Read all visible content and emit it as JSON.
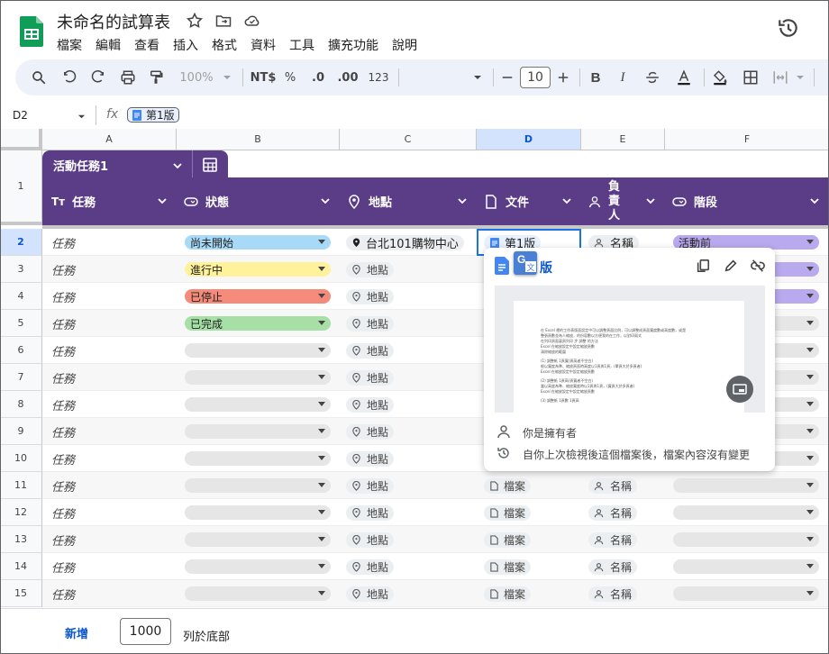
{
  "app": {
    "title": "未命名的試算表",
    "menus": [
      "檔案",
      "編輯",
      "查看",
      "插入",
      "格式",
      "資料",
      "工具",
      "擴充功能",
      "說明"
    ]
  },
  "toolbar": {
    "zoom": "100%",
    "currency": "NT$",
    "percent": "%",
    "dec_decrease": ".0",
    "dec_increase": ".00",
    "number_format": "123",
    "font_size": "10",
    "bold": "B",
    "italic": "I"
  },
  "formula_bar": {
    "cell_ref": "D2",
    "fx": "fx",
    "content": "第1版"
  },
  "columns": [
    "A",
    "B",
    "C",
    "D",
    "E",
    "F"
  ],
  "table": {
    "name": "活動任務1",
    "headers": {
      "task": "任務",
      "status": "狀態",
      "location": "地點",
      "document": "文件",
      "owner": "負責人",
      "stage": "階段"
    },
    "rows": [
      {
        "num": "2",
        "task": "任務",
        "status": "尚未開始",
        "location": "台北101購物中心",
        "document": "第1版",
        "owner": "名稱",
        "stage": "活動前"
      },
      {
        "num": "3",
        "task": "任務",
        "status": "進行中",
        "location": "地點",
        "document": "",
        "owner": "",
        "stage": ""
      },
      {
        "num": "4",
        "task": "任務",
        "status": "已停止",
        "location": "地點",
        "document": "",
        "owner": "",
        "stage": ""
      },
      {
        "num": "5",
        "task": "任務",
        "status": "已完成",
        "location": "地點",
        "document": "",
        "owner": "",
        "stage": ""
      },
      {
        "num": "6",
        "task": "任務",
        "status": "",
        "location": "地點",
        "document": "",
        "owner": "",
        "stage": ""
      },
      {
        "num": "7",
        "task": "任務",
        "status": "",
        "location": "地點",
        "document": "",
        "owner": "",
        "stage": ""
      },
      {
        "num": "8",
        "task": "任務",
        "status": "",
        "location": "地點",
        "document": "",
        "owner": "",
        "stage": ""
      },
      {
        "num": "9",
        "task": "任務",
        "status": "",
        "location": "地點",
        "document": "",
        "owner": "",
        "stage": ""
      },
      {
        "num": "10",
        "task": "任務",
        "status": "",
        "location": "地點",
        "document": "",
        "owner": "",
        "stage": ""
      },
      {
        "num": "11",
        "task": "任務",
        "status": "",
        "location": "地點",
        "document": "檔案",
        "owner": "名稱",
        "stage": ""
      },
      {
        "num": "12",
        "task": "任務",
        "status": "",
        "location": "地點",
        "document": "檔案",
        "owner": "名稱",
        "stage": ""
      },
      {
        "num": "13",
        "task": "任務",
        "status": "",
        "location": "地點",
        "document": "檔案",
        "owner": "名稱",
        "stage": ""
      },
      {
        "num": "14",
        "task": "任務",
        "status": "",
        "location": "地點",
        "document": "檔案",
        "owner": "名稱",
        "stage": ""
      },
      {
        "num": "15",
        "task": "任務",
        "status": "",
        "location": "地點",
        "document": "檔案",
        "owner": "名稱",
        "stage": ""
      }
    ],
    "header_row_num": "1",
    "status_colors": {
      "尚未開始": "#a8daf8",
      "進行中": "#fff29a",
      "已停止": "#f58b7b",
      "已完成": "#a6e0a6",
      "empty": "#e6e6e6"
    },
    "stage_color": "#b9a9ee",
    "header_color": "#5a3c87"
  },
  "popup": {
    "title_suffix": "版",
    "owner_text": "你是擁有者",
    "change_text": "自你上次檢視後這個檔案後，檔案內容沒有變更",
    "preview_lines": [
      "在 Excel 裡的工作表版面設定中可以調整頁面比例，可以調整成頁面寬度數或高度數，或是",
      "整張頁數並為人縮放，的份容數以方便我的在工作，以對印兩式",
      "在列印頁面裏頁列印 步 調整 的方法",
      "Excel 在縮放設定中設定縮放頁數",
      "清除縮放的範圍",
      "(1) 調整紙 1頁寬(頁高者不空白)",
      "根以寬度為準、縮放頁面時高度以1頁與1頁，(單頁大於多頁者)",
      "Excel 在縮放設定中設定縮放頁數",
      "(2) 調整紙 1頁高(頁寬者不空白)",
      "當以高度為準、縮放寬度時以1頁與1頁，(寬頁大於多頁者)",
      "Excel 在縮放設定中設定縮放頁數",
      "(3) 調整紙 1頁數 1頁高"
    ]
  },
  "bottom": {
    "add_label": "新增",
    "count": "1000",
    "suffix": "列於底部"
  }
}
